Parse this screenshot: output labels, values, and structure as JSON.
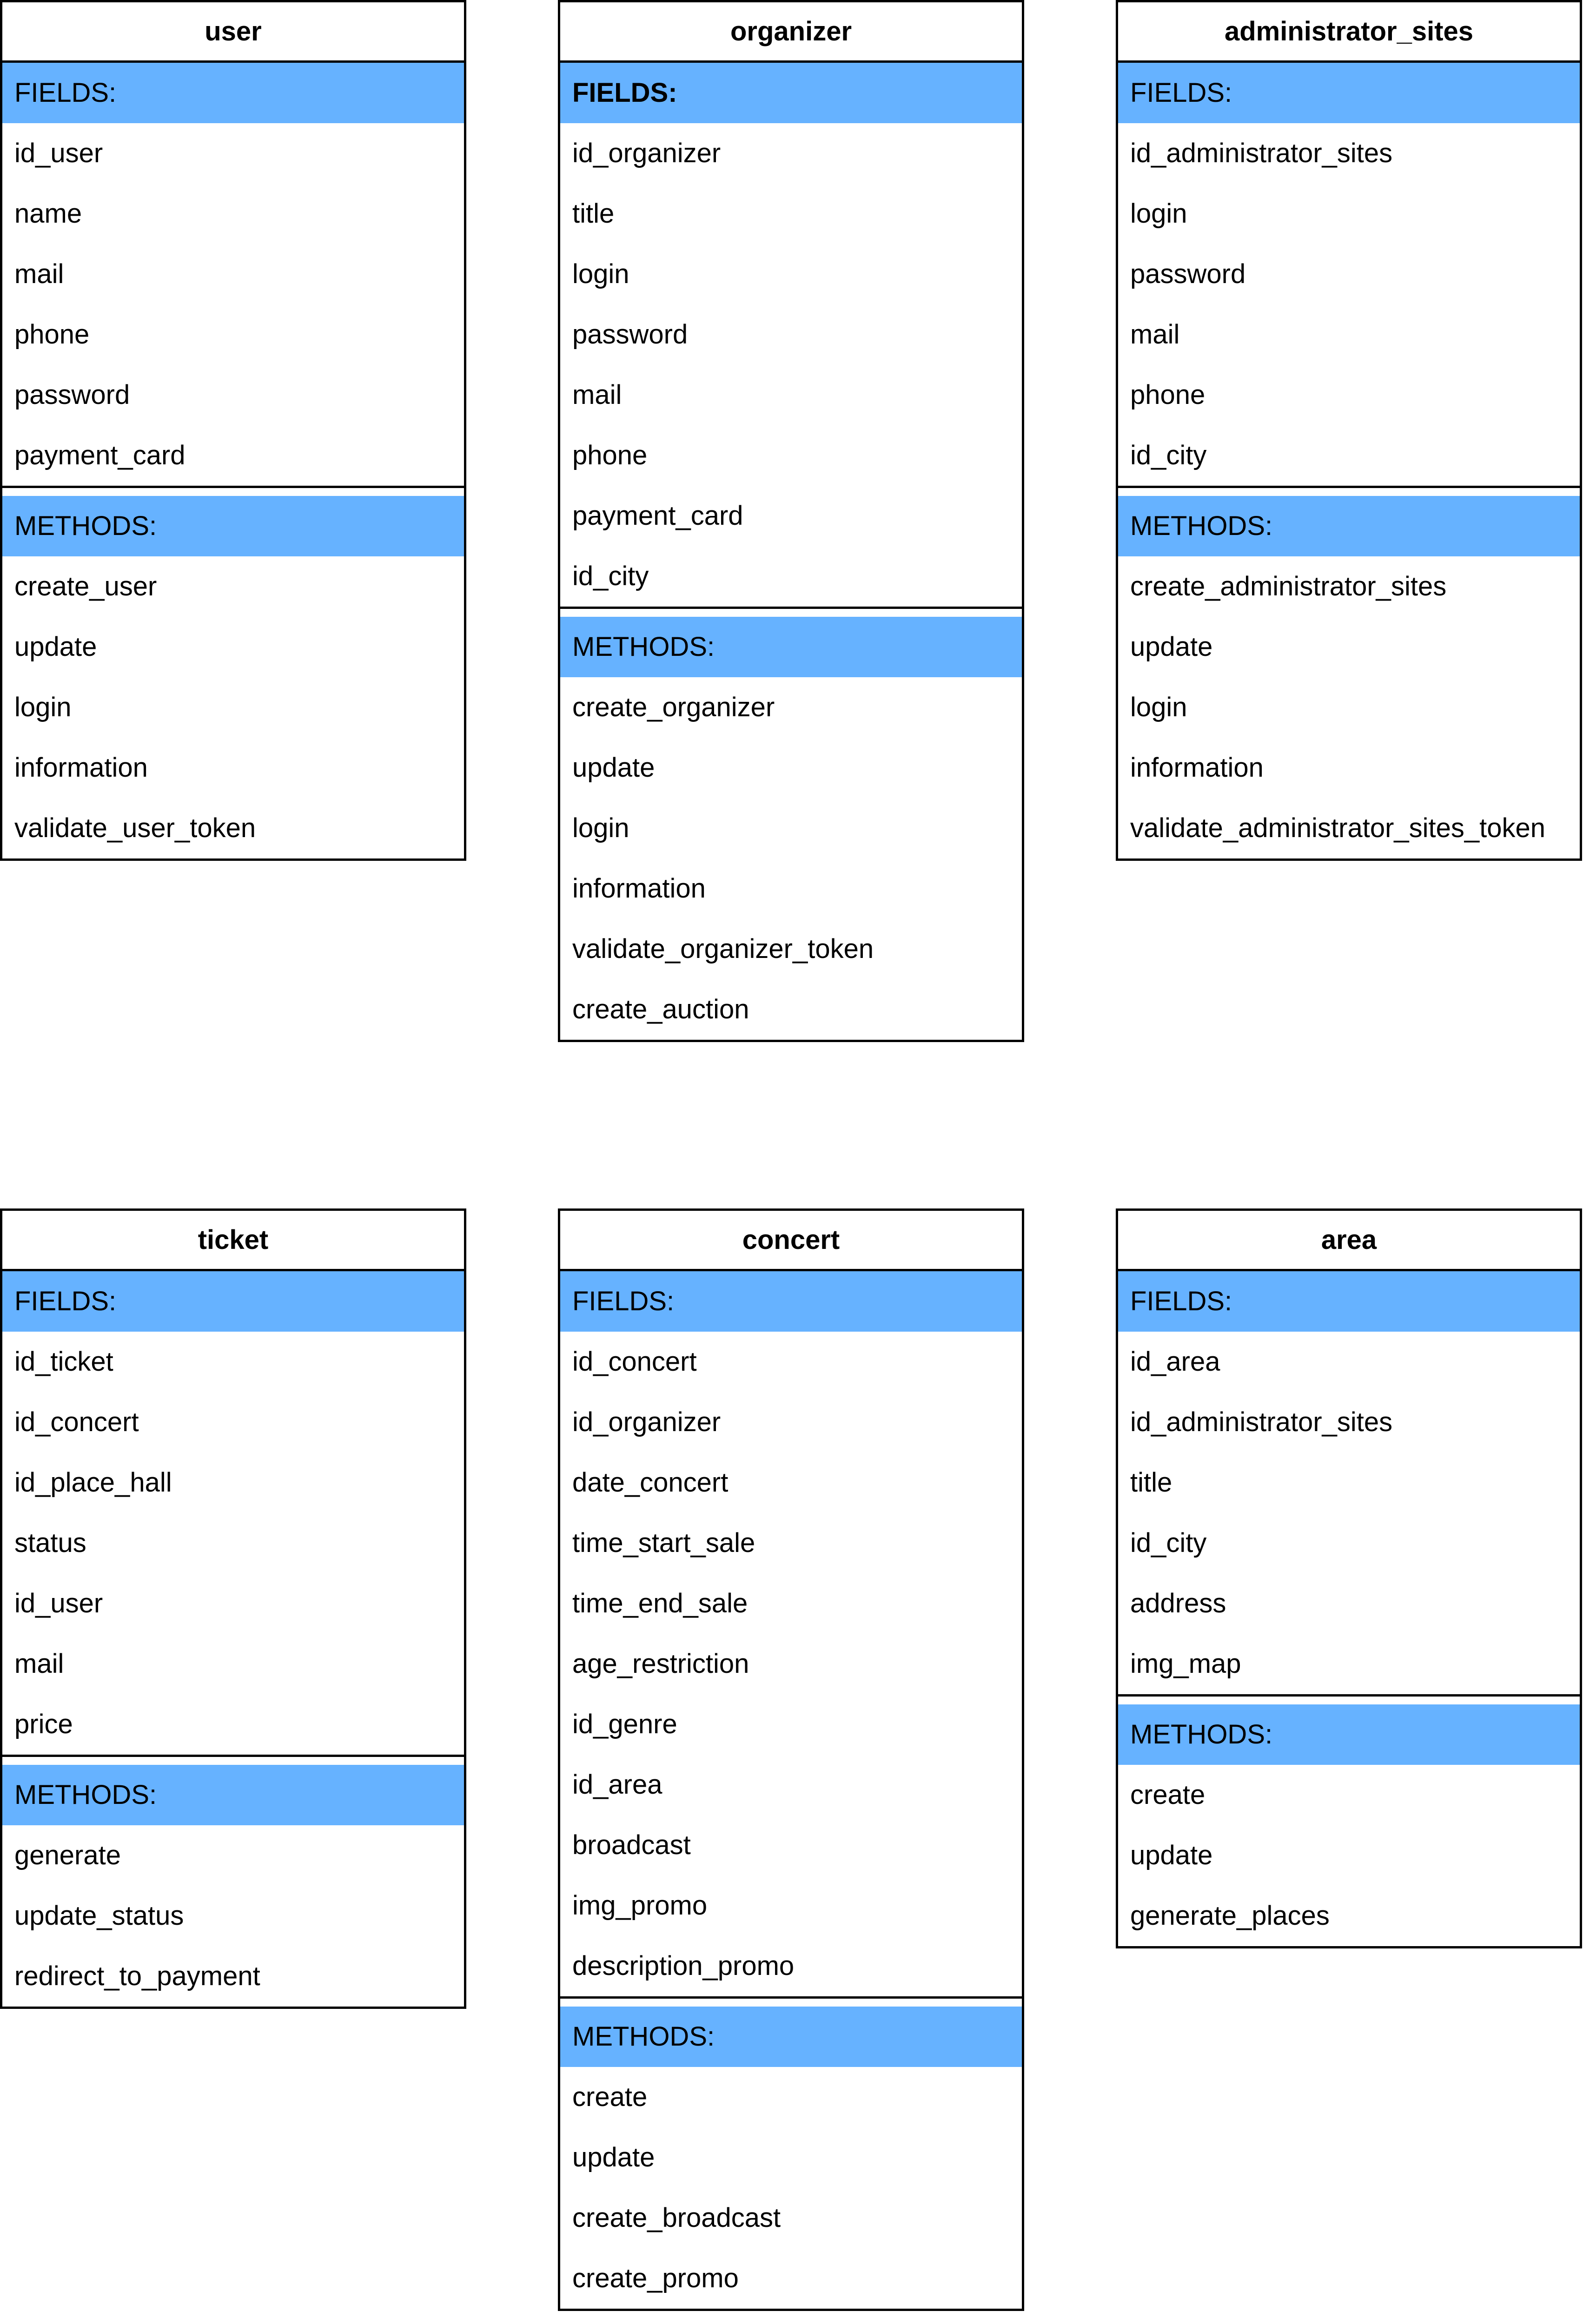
{
  "classes": [
    {
      "key": "user",
      "title": "user",
      "fields_label": "FIELDS:",
      "fields_bold": false,
      "fields": [
        "id_user",
        "name",
        "mail",
        "phone",
        "password",
        "payment_card"
      ],
      "methods_label": "METHODS:",
      "methods": [
        "create_user",
        "update",
        "login",
        "information",
        "validate_user_token"
      ]
    },
    {
      "key": "organizer",
      "title": "organizer",
      "fields_label": "FIELDS:",
      "fields_bold": true,
      "fields": [
        "id_organizer",
        "title",
        "login",
        "password",
        "mail",
        "phone",
        "payment_card",
        "id_city"
      ],
      "methods_label": "METHODS:",
      "methods": [
        "create_organizer",
        "update",
        "login",
        "information",
        "validate_organizer_token",
        "create_auction"
      ]
    },
    {
      "key": "administrator-sites",
      "title": "administrator_sites",
      "fields_label": "FIELDS:",
      "fields_bold": false,
      "fields": [
        "id_administrator_sites",
        "login",
        "password",
        "mail",
        "phone",
        "id_city"
      ],
      "methods_label": "METHODS:",
      "methods": [
        "create_administrator_sites",
        "update",
        "login",
        "information",
        "validate_administrator_sites_token"
      ]
    },
    {
      "key": "ticket",
      "title": "ticket",
      "fields_label": "FIELDS:",
      "fields_bold": false,
      "fields": [
        "id_ticket",
        "id_concert",
        "id_place_hall",
        "status",
        "id_user",
        "mail",
        "price"
      ],
      "methods_label": "METHODS:",
      "methods": [
        "generate",
        "update_status",
        "redirect_to_payment"
      ]
    },
    {
      "key": "concert",
      "title": "concert",
      "fields_label": "FIELDS:",
      "fields_bold": false,
      "fields": [
        "id_concert",
        "id_organizer",
        "date_concert",
        "time_start_sale",
        "time_end_sale",
        "age_restriction",
        "id_genre",
        "id_area",
        "broadcast",
        "img_promo",
        "description_promo"
      ],
      "methods_label": "METHODS:",
      "methods": [
        "create",
        "update",
        "create_broadcast",
        "create_promo"
      ]
    },
    {
      "key": "area",
      "title": "area",
      "fields_label": "FIELDS:",
      "fields_bold": false,
      "fields": [
        "id_area",
        "id_administrator_sites",
        "title",
        "id_city",
        "address",
        "img_map"
      ],
      "methods_label": "METHODS:",
      "methods": [
        "create",
        "update",
        "generate_places"
      ]
    }
  ],
  "colors": {
    "section_header_fill": "#66b2ff",
    "border": "#000000",
    "background": "#ffffff"
  }
}
